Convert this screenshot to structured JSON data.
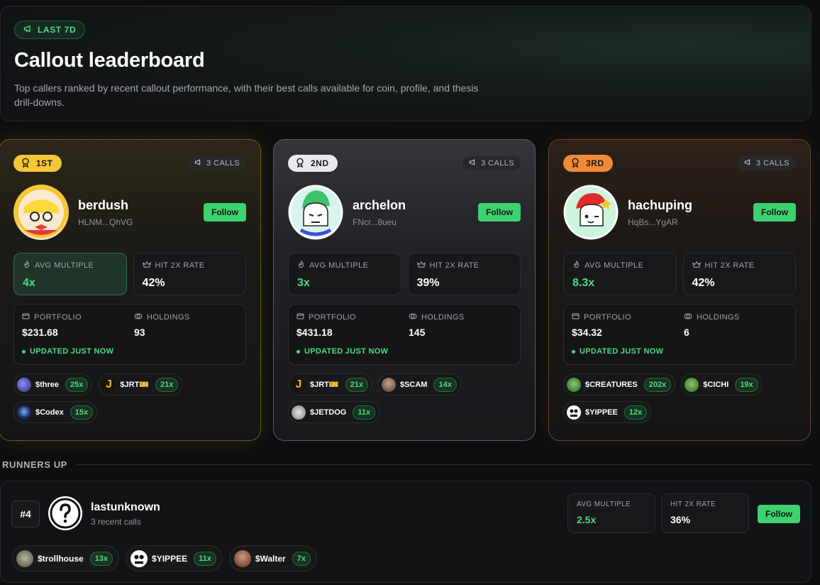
{
  "hero": {
    "badge": "LAST 7D",
    "title": "Callout leaderboard",
    "description": "Top callers ranked by recent callout performance, with their best calls available for coin, profile, and thesis drill-downs."
  },
  "podium": [
    {
      "rank_label": "1ST",
      "calls": "3 CALLS",
      "name": "berdush",
      "address": "HLNM...QhVG",
      "follow": "Follow",
      "avg_label": "AVG MULTIPLE",
      "avg_value": "4x",
      "hit_label": "HIT 2X RATE",
      "hit_value": "42%",
      "portfolio_label": "PORTFOLIO",
      "portfolio_value": "$231.68",
      "holdings_label": "HOLDINGS",
      "holdings_value": "93",
      "updated": "UPDATED JUST NOW",
      "coins": [
        {
          "name": "$three",
          "mult": "25x"
        },
        {
          "name": "$JRT🎫",
          "mult": "21x"
        },
        {
          "name": "$Codex",
          "mult": "15x"
        }
      ]
    },
    {
      "rank_label": "2ND",
      "calls": "3 CALLS",
      "name": "archelon",
      "address": "FNcr...8ueu",
      "follow": "Follow",
      "avg_label": "AVG MULTIPLE",
      "avg_value": "3x",
      "hit_label": "HIT 2X RATE",
      "hit_value": "39%",
      "portfolio_label": "PORTFOLIO",
      "portfolio_value": "$431.18",
      "holdings_label": "HOLDINGS",
      "holdings_value": "145",
      "updated": "UPDATED JUST NOW",
      "coins": [
        {
          "name": "$JRT🎫",
          "mult": "21x"
        },
        {
          "name": "$SCAM",
          "mult": "14x"
        },
        {
          "name": "$JETDOG",
          "mult": "11x"
        }
      ]
    },
    {
      "rank_label": "3RD",
      "calls": "3 CALLS",
      "name": "hachuping",
      "address": "HqBs...YgAR",
      "follow": "Follow",
      "avg_label": "AVG MULTIPLE",
      "avg_value": "8.3x",
      "hit_label": "HIT 2X RATE",
      "hit_value": "42%",
      "portfolio_label": "PORTFOLIO",
      "portfolio_value": "$34.32",
      "holdings_label": "HOLDINGS",
      "holdings_value": "6",
      "updated": "UPDATED JUST NOW",
      "coins": [
        {
          "name": "$CREATURES",
          "mult": "202x"
        },
        {
          "name": "$CICHI",
          "mult": "19x"
        },
        {
          "name": "$YIPPEE",
          "mult": "12x"
        }
      ]
    }
  ],
  "runners_up": {
    "title": "RUNNERS UP",
    "entries": [
      {
        "rank": "#4",
        "name": "lastunknown",
        "subtitle": "3 recent calls",
        "avg_label": "AVG MULTIPLE",
        "avg_value": "2.5x",
        "hit_label": "HIT 2X RATE",
        "hit_value": "36%",
        "follow": "Follow",
        "coins": [
          {
            "name": "$trollhouse",
            "mult": "13x"
          },
          {
            "name": "$YIPPEE",
            "mult": "11x"
          },
          {
            "name": "$Walter",
            "mult": "7x"
          }
        ]
      }
    ]
  },
  "colors": {
    "gold": "#f4c734",
    "silver": "#e7e9ec",
    "bronze": "#f08a3a",
    "accent_green": "#3ed16f"
  },
  "icons": {
    "badge": "megaphone-icon",
    "rank": "medal-icon",
    "calls": "megaphone-icon",
    "avg": "flame-icon",
    "hit": "crown-icon",
    "portfolio": "wallet-icon",
    "holdings": "coins-icon"
  }
}
